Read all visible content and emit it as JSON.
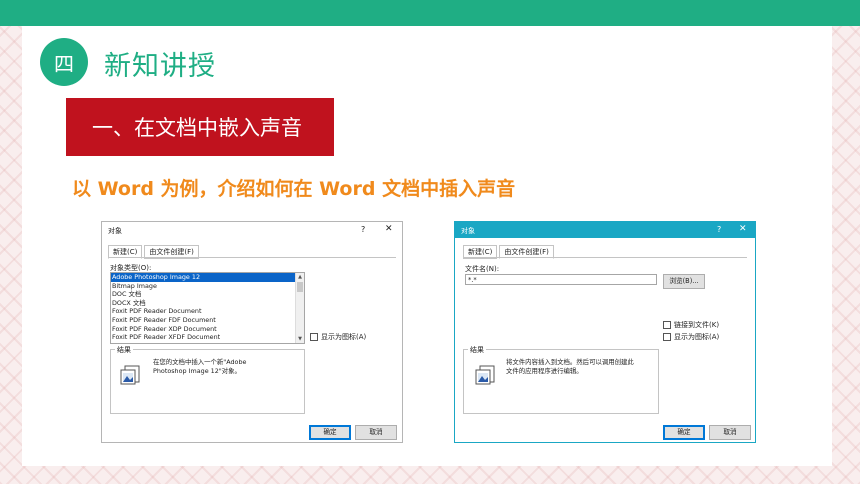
{
  "slide": {
    "section_number": "四",
    "section_title": "新知讲授",
    "banner_text": "一、在文档中嵌入声音",
    "subtitle": "以 Word 为例，介绍如何在 Word 文档中插入声音",
    "colors": {
      "accent_green": "#1fae84",
      "banner_red": "#c0121e",
      "subtitle_orange": "#f08a1c"
    }
  },
  "dialog_left": {
    "title": "对象",
    "help": "?",
    "close": "✕",
    "tabs": [
      "新建(C)",
      "由文件创建(F)"
    ],
    "object_type_label": "对象类型(O):",
    "object_types": [
      "Adobe Photoshop Image 12",
      "Bitmap Image",
      "DOC 文档",
      "DOCX 文档",
      "Foxit PDF Reader Document",
      "Foxit PDF Reader FDF Document",
      "Foxit PDF Reader XDP Document",
      "Foxit PDF Reader XFDF Document"
    ],
    "selected_index": 0,
    "display_as_icon": "显示为图标(A)",
    "result_label": "结果",
    "result_text_line1": "在您的文档中插入一个新\"Adobe",
    "result_text_line2": "Photoshop Image 12\"对象。",
    "ok": "确定",
    "cancel": "取消"
  },
  "dialog_right": {
    "title": "对象",
    "help": "?",
    "close": "✕",
    "tabs": [
      "新建(C)",
      "由文件创建(F)"
    ],
    "file_name_label": "文件名(N):",
    "file_name_value": "*.*",
    "browse": "浏览(B)...",
    "link_to_file": "链接到文件(K)",
    "display_as_icon": "显示为图标(A)",
    "result_label": "结果",
    "result_text_line1": "将文件内容插入到文档。然后可以调用创建此",
    "result_text_line2": "文件的应用程序进行编辑。",
    "ok": "确定",
    "cancel": "取消"
  }
}
